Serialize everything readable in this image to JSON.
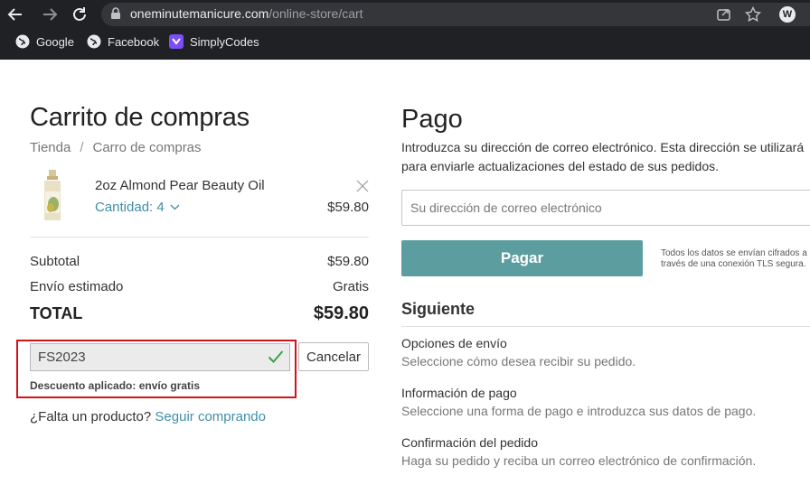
{
  "browser": {
    "url_domain": "oneminutemanicure.com",
    "url_path": "/online-store/cart",
    "bookmarks": [
      {
        "label": "Google",
        "icon": "globe-icon"
      },
      {
        "label": "Facebook",
        "icon": "globe-icon"
      },
      {
        "label": "SimplyCodes",
        "icon": "simplycodes-icon"
      }
    ]
  },
  "cart": {
    "title": "Carrito de compras",
    "breadcrumb": [
      "Tienda",
      "/",
      "Carro de compras"
    ],
    "item": {
      "name": "2oz Almond Pear Beauty Oil",
      "quantity_label": "Cantidad: 4",
      "price": "$59.80"
    },
    "subtotal_label": "Subtotal",
    "subtotal_value": "$59.80",
    "shipping_label": "Envío estimado",
    "shipping_value": "Gratis",
    "total_label": "TOTAL",
    "total_value": "$59.80",
    "promo_code": "FS2023",
    "cancel_label": "Cancelar",
    "discount_message": "Descuento aplicado: envío gratis",
    "missing_prefix": "¿Falta un producto?",
    "missing_link": "Seguir comprando"
  },
  "payment": {
    "title": "Pago",
    "description": "Introduzca su dirección de correo electrónico. Esta dirección se utilizará para enviarle actualizaciones del estado de sus pedidos.",
    "email_placeholder": "Su dirección de correo electrónico",
    "pay_label": "Pagar",
    "tls_note": "Todos los datos se envían cifrados a través de una conexión TLS segura.",
    "next_title": "Siguiente",
    "steps": [
      {
        "title": "Opciones de envío",
        "desc": "Seleccione cómo desea recibir su pedido."
      },
      {
        "title": "Información de pago",
        "desc": "Seleccione una forma de pago e introduzca sus datos de pago."
      },
      {
        "title": "Confirmación del pedido",
        "desc": "Haga su pedido y reciba un correo electrónico de confirmación."
      }
    ]
  },
  "colors": {
    "accent": "#3f8ea8",
    "pay_button": "#5c9ea0",
    "highlight": "#d0141b",
    "chrome_bg": "#202124"
  }
}
